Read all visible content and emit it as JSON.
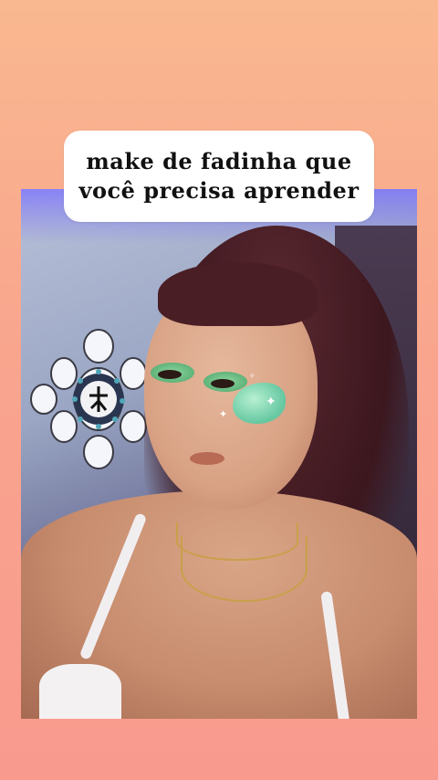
{
  "caption": {
    "line1": "make de fadinha que",
    "line2": "você precisa aprender"
  },
  "photo": {
    "subject": "selfie",
    "background_colors": [
      "#b8c0d8",
      "#6c6f95",
      "#3b2f45"
    ]
  },
  "colors": {
    "background_top": "#f9b88f",
    "background_bottom": "#f99a8e",
    "caption_bg": "#ffffff",
    "caption_text": "#111111",
    "eyeshadow": "#5fb37a"
  },
  "icons": {
    "mandala": "mandala-decoration",
    "sparkles": "sparkle-icon"
  }
}
